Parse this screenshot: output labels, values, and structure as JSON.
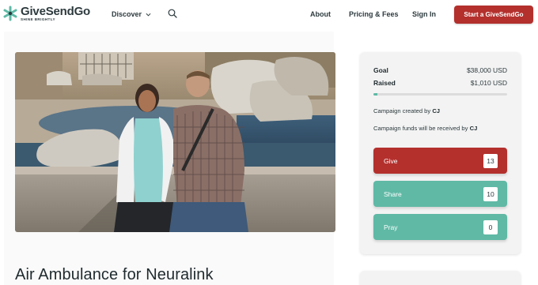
{
  "header": {
    "logo_name": "GiveSendGo",
    "logo_tagline": "SHINE BRIGHTLY",
    "discover_label": "Discover",
    "about_label": "About",
    "pricing_label": "Pricing & Fees",
    "signin_label": "Sign In",
    "start_button_label": "Start a GiveSendGo"
  },
  "campaign": {
    "title": "Air Ambulance for Neuralink",
    "goal_label": "Goal",
    "goal_value": "$38,000 USD",
    "raised_label": "Raised",
    "raised_value": "$1,010 USD",
    "progress_fraction": 0.027,
    "created_by_text": "Campaign created by",
    "created_by_name": "CJ",
    "funds_text": "Campaign funds will be received by",
    "funds_name": "CJ"
  },
  "actions": {
    "give_label": "Give",
    "give_count": "13",
    "share_label": "Share",
    "share_count": "10",
    "pray_label": "Pray",
    "pray_count": "0"
  },
  "colors": {
    "brand_red": "#b3302d",
    "brand_teal": "#5fb9a5"
  }
}
